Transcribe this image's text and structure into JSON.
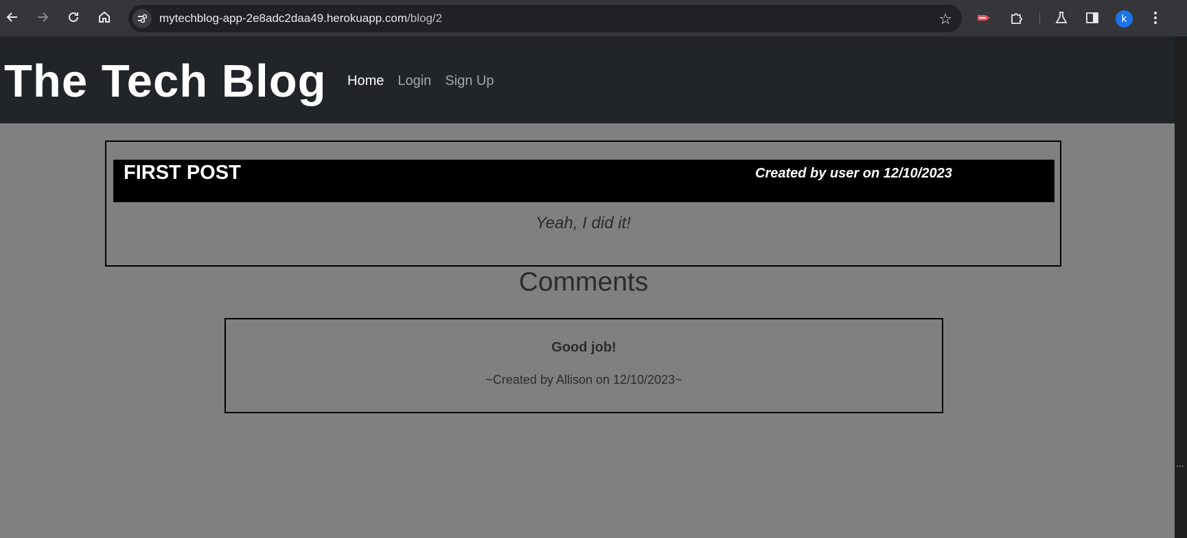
{
  "browser": {
    "url_host": "mytechblog-app-2e8adc2daa49.herokuapp.com",
    "url_path": "/blog/2",
    "profile_initial": "k",
    "icons": [
      "back-icon",
      "forward-icon",
      "reload-icon",
      "home-icon",
      "site-info-icon",
      "bookmark-star-icon",
      "extension-red-icon",
      "extensions-puzzle-icon",
      "labs-flask-icon",
      "side-panel-icon",
      "more-menu-icon"
    ]
  },
  "header": {
    "brand": "The Tech Blog",
    "nav": [
      {
        "label": "Home"
      },
      {
        "label": "Login"
      },
      {
        "label": "Sign Up"
      }
    ]
  },
  "post": {
    "title": "FIRST POST",
    "meta": "Created by user on 12/10/2023",
    "body": "Yeah, I did it!"
  },
  "comments": {
    "heading": "Comments",
    "items": [
      {
        "text": "Good job!",
        "meta": "~Created by Allison on 12/10/2023~"
      }
    ]
  }
}
